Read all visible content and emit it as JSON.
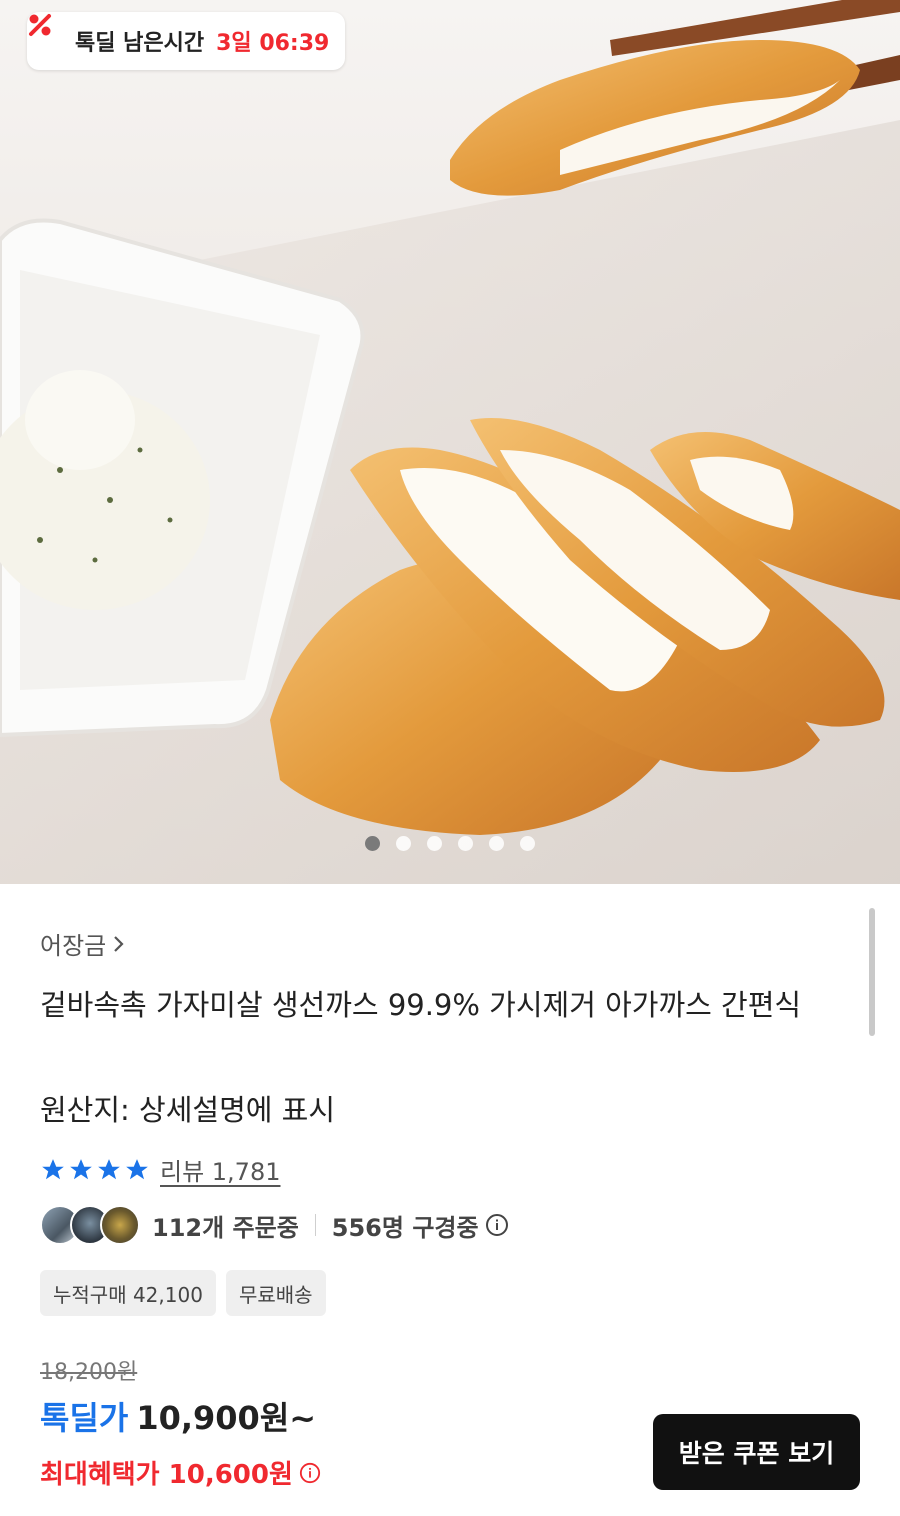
{
  "deal_banner": {
    "label": "톡딜 남은시간",
    "time_left": "3일 06:39",
    "accent_color": "#f0292f",
    "icon": "percent-icon"
  },
  "gallery": {
    "image_subject": "fish-cutlet-with-tartar-sauce",
    "dot_count": 6,
    "active_index": 0
  },
  "product": {
    "brand": "어장금",
    "title": "겉바속촉 가자미살 생선까스 99.9% 가시제거 아가까스 간편식",
    "origin": "원산지: 상세설명에 표시"
  },
  "rating": {
    "stars_filled": 4,
    "review_label": "리뷰 1,781"
  },
  "social_proof": {
    "orders": "112개 주문중",
    "viewers": "556명 구경중"
  },
  "tags": [
    {
      "label": "누적구매 42,100"
    },
    {
      "label": "무료배송"
    }
  ],
  "price": {
    "original": "18,200원",
    "sale_label": "톡딜가",
    "sale_price": "10,900원~",
    "max_benefit": "최대혜택가 10,600원",
    "sale_color": "#1a73e8"
  },
  "coupon_button": {
    "label": "받은 쿠폰 보기"
  }
}
